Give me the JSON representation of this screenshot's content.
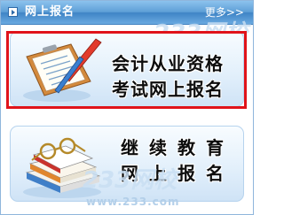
{
  "header": {
    "title": "网上报名",
    "more_label": "更多>>"
  },
  "banners": [
    {
      "line1": "会计从业资格",
      "line2": "考试网上报名"
    },
    {
      "line1": "继续教育",
      "line2": "网上报名"
    }
  ],
  "watermark": {
    "text": "233网校",
    "url": "www.233.com"
  },
  "colors": {
    "header_blue": "#5e9fd6",
    "highlight_red": "#e0131a",
    "banner_light": "#e3f0fb"
  }
}
